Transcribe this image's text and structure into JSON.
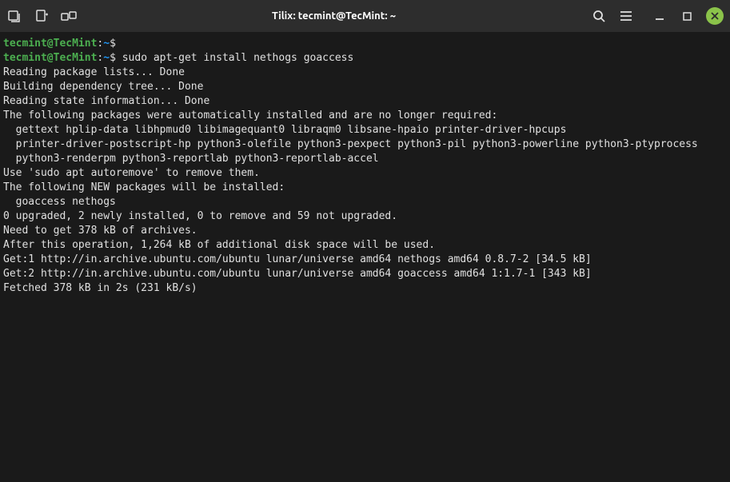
{
  "titlebar": {
    "title": "Tilix: tecmint@TecMint: ~"
  },
  "prompt": {
    "user_host": "tecmint@TecMint",
    "colon": ":",
    "path": "~",
    "symbol": "$"
  },
  "commands": {
    "cmd1": "",
    "cmd2": " sudo apt-get install nethogs goaccess"
  },
  "output": {
    "l1": "Reading package lists... Done",
    "l2": "Building dependency tree... Done",
    "l3": "Reading state information... Done",
    "l4": "The following packages were automatically installed and are no longer required:",
    "l5": "  gettext hplip-data libhpmud0 libimagequant0 libraqm0 libsane-hpaio printer-driver-hpcups",
    "l6": "  printer-driver-postscript-hp python3-olefile python3-pexpect python3-pil python3-powerline python3-ptyprocess",
    "l7": "  python3-renderpm python3-reportlab python3-reportlab-accel",
    "l8": "Use 'sudo apt autoremove' to remove them.",
    "l9": "The following NEW packages will be installed:",
    "l10": "  goaccess nethogs",
    "l11": "0 upgraded, 2 newly installed, 0 to remove and 59 not upgraded.",
    "l12": "Need to get 378 kB of archives.",
    "l13": "After this operation, 1,264 kB of additional disk space will be used.",
    "l14": "Get:1 http://in.archive.ubuntu.com/ubuntu lunar/universe amd64 nethogs amd64 0.8.7-2 [34.5 kB]",
    "l15": "Get:2 http://in.archive.ubuntu.com/ubuntu lunar/universe amd64 goaccess amd64 1:1.7-1 [343 kB]",
    "l16": "Fetched 378 kB in 2s (231 kB/s)"
  }
}
